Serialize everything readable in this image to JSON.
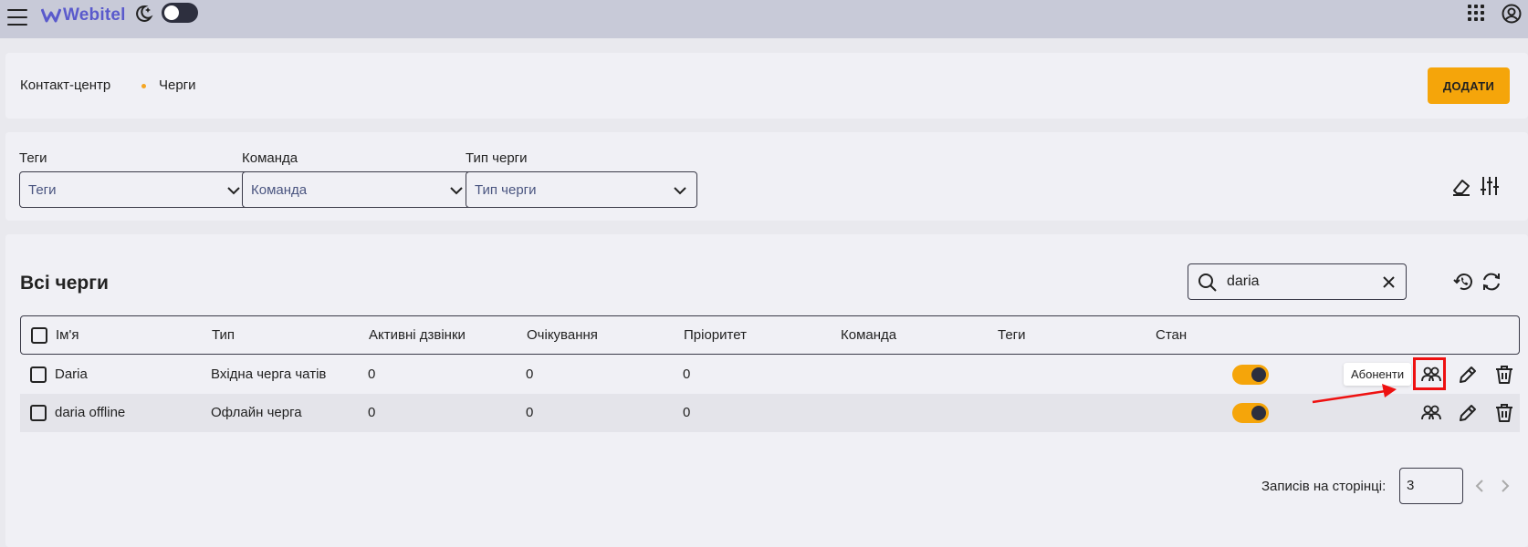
{
  "header": {
    "app_name": "Webitel",
    "icons": [
      "menu-icon",
      "webitel-logo",
      "moon-icon",
      "apps-grid-icon",
      "account-icon"
    ],
    "theme_toggle": "dark-mode-toggle"
  },
  "breadcrumb": {
    "items": [
      "Контакт-центр",
      "Черги"
    ]
  },
  "add_button": "ДОДАТИ",
  "filters": [
    {
      "label": "Теги",
      "placeholder": "Теги"
    },
    {
      "label": "Команда",
      "placeholder": "Команда"
    },
    {
      "label": "Тип черги",
      "placeholder": "Тип черги"
    }
  ],
  "table_section": {
    "title": "Всі черги",
    "search_value": "daria",
    "columns": [
      "Ім'я",
      "Тип",
      "Активні дзвінки",
      "Очікування",
      "Пріоритет",
      "Команда",
      "Теги",
      "Стан"
    ],
    "rows": [
      {
        "name": "Daria",
        "type": "Вхідна черга чатів",
        "active": "0",
        "waiting": "0",
        "priority": "0",
        "team": "",
        "tags": "",
        "state": "on"
      },
      {
        "name": "daria offline",
        "type": "Офлайн черга",
        "active": "0",
        "waiting": "0",
        "priority": "0",
        "team": "",
        "tags": "",
        "state": "on"
      }
    ],
    "tooltip": "Абоненти"
  },
  "pagination": {
    "label": "Записів на сторінці:",
    "per_page": "3"
  },
  "colors": {
    "accent": "#f5a50a",
    "topbar": "#c8cad8",
    "annotation": "#e11111"
  }
}
